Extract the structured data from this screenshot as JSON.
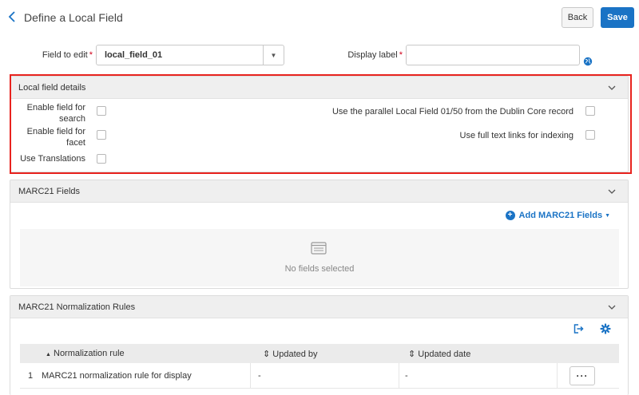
{
  "header": {
    "title": "Define a Local Field",
    "back_label": "Back",
    "save_label": "Save"
  },
  "form": {
    "field_to_edit_label": "Field to edit",
    "field_to_edit_value": "local_field_01",
    "display_label_label": "Display label",
    "display_label_value": "",
    "required_marker": "*"
  },
  "local_field_details": {
    "title": "Local field details",
    "options": {
      "enable_search": {
        "label_line1": "Enable field for",
        "label_line2": "search",
        "checked": false
      },
      "enable_facet": {
        "label_line1": "Enable field for",
        "label_line2": "facet",
        "checked": false
      },
      "use_translations": {
        "label": "Use Translations",
        "checked": false
      },
      "use_parallel": {
        "label": "Use the parallel Local Field 01/50 from the Dublin Core record",
        "checked": false
      },
      "full_text_links": {
        "label": "Use full text links for indexing",
        "checked": false
      }
    }
  },
  "marc21_fields": {
    "title": "MARC21 Fields",
    "add_label": "Add MARC21 Fields",
    "empty_text": "No fields selected"
  },
  "normalization": {
    "title": "MARC21 Normalization Rules",
    "columns": {
      "rule": "Normalization rule",
      "updated_by": "Updated by",
      "updated_date": "Updated date"
    },
    "sort_asc_glyph": "▲",
    "sort_glyph": "⇕",
    "rows": [
      {
        "index": "1",
        "rule": "MARC21 normalization rule for display",
        "updated_by": "-",
        "updated_date": "-",
        "more": "···"
      }
    ]
  },
  "colors": {
    "accent": "#1a73c5",
    "highlight": "#e8231e",
    "required": "#d0021b"
  },
  "icons": {
    "back": "chevron-left-icon",
    "globe": "globe-icon",
    "collapse": "chevron-down-icon",
    "add": "plus-circle-icon",
    "empty": "list-icon",
    "export": "export-icon",
    "settings": "gear-icon"
  }
}
